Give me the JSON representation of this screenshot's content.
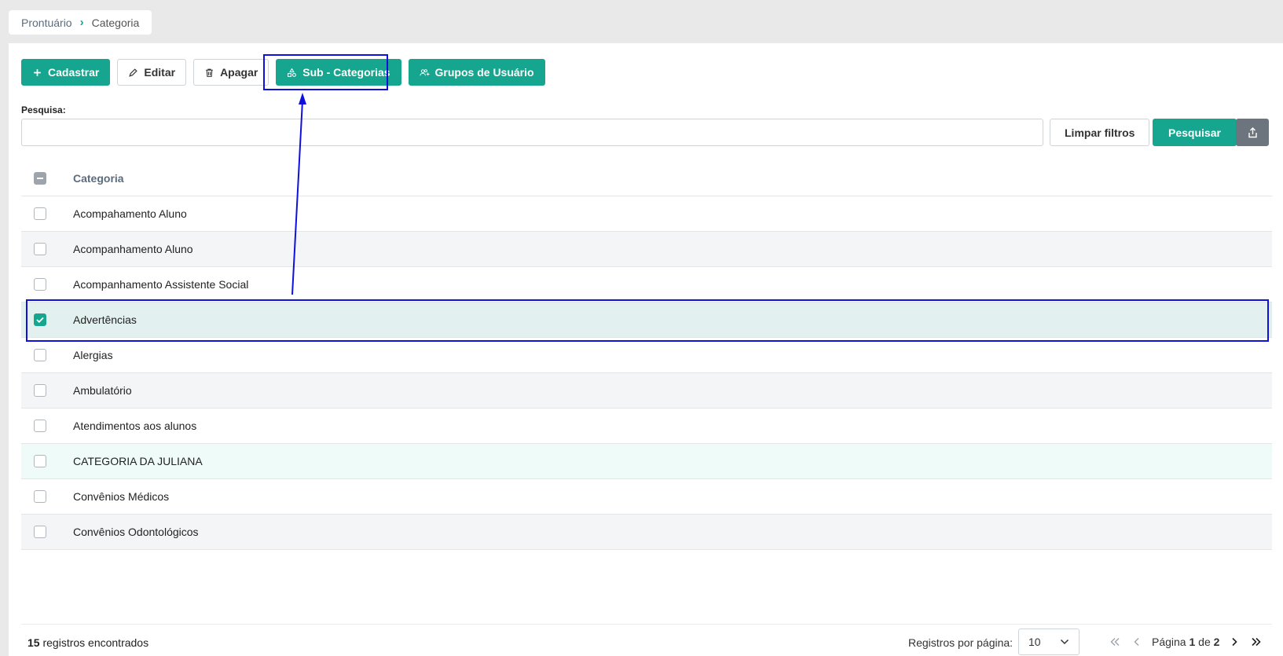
{
  "breadcrumb": {
    "root": "Prontuário",
    "current": "Categoria"
  },
  "toolbar": {
    "cadastrar": "Cadastrar",
    "editar": "Editar",
    "apagar": "Apagar",
    "sub_categorias": "Sub - Categorias",
    "grupos_usuario": "Grupos de Usuário"
  },
  "search": {
    "label": "Pesquisa:",
    "value": "",
    "placeholder": "",
    "clear_label": "Limpar filtros",
    "search_label": "Pesquisar"
  },
  "table": {
    "header": "Categoria",
    "rows": [
      {
        "label": "Acompahamento Aluno",
        "checked": false
      },
      {
        "label": "Acompanhamento Aluno",
        "checked": false
      },
      {
        "label": "Acompanhamento Assistente Social",
        "checked": false
      },
      {
        "label": "Advertências",
        "checked": true
      },
      {
        "label": "Alergias",
        "checked": false
      },
      {
        "label": "Ambulatório",
        "checked": false
      },
      {
        "label": "Atendimentos aos alunos",
        "checked": false
      },
      {
        "label": "CATEGORIA DA JULIANA",
        "checked": false
      },
      {
        "label": "Convênios Médicos",
        "checked": false
      },
      {
        "label": "Convênios Odontológicos",
        "checked": false
      }
    ]
  },
  "footer": {
    "count": "15",
    "count_suffix": "registros encontrados",
    "per_page_label": "Registros por página:",
    "per_page_value": "10",
    "page_word": "Página",
    "page_current": "1",
    "page_of": "de",
    "page_total": "2"
  },
  "colors": {
    "accent": "#16a58e",
    "annotation": "#1010dd"
  }
}
